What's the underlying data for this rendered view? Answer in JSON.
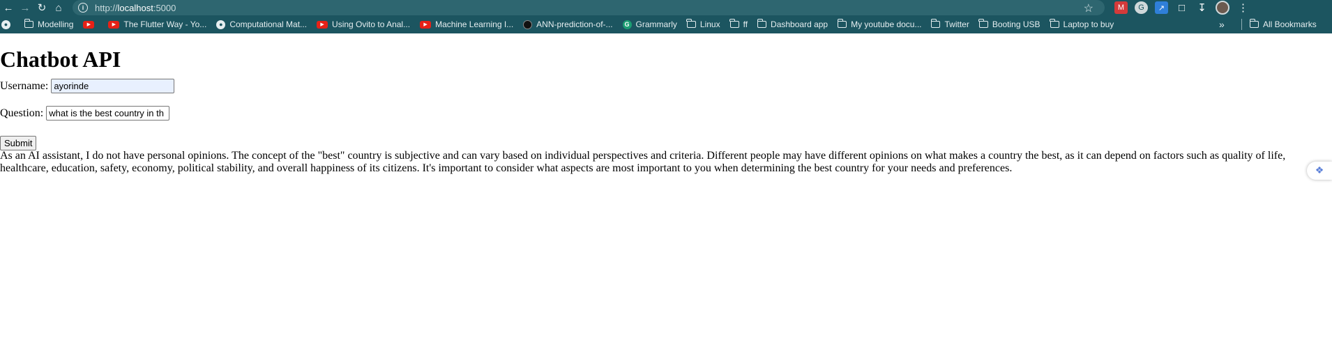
{
  "browser": {
    "url_prefix": "http://",
    "url_host": "localhost",
    "url_port": ":5000",
    "bookmarks": [
      {
        "label": "Modelling",
        "icon": "folder-icon"
      },
      {
        "label": "",
        "icon": "youtube-icon"
      },
      {
        "label": "The Flutter Way - Yo...",
        "icon": "youtube-icon"
      },
      {
        "label": "Computational Mat...",
        "icon": "globe-icon"
      },
      {
        "label": "Using Ovito to Anal...",
        "icon": "youtube-icon"
      },
      {
        "label": "Machine Learning I...",
        "icon": "youtube-icon"
      },
      {
        "label": "ANN-prediction-of-...",
        "icon": "github-icon"
      },
      {
        "label": "Grammarly",
        "icon": "grammarly-icon"
      },
      {
        "label": "Linux",
        "icon": "folder-icon"
      },
      {
        "label": "ff",
        "icon": "folder-icon"
      },
      {
        "label": "Dashboard app",
        "icon": "folder-icon"
      },
      {
        "label": "My youtube docu...",
        "icon": "folder-icon"
      },
      {
        "label": "Twitter",
        "icon": "folder-icon"
      },
      {
        "label": "Booting USB",
        "icon": "folder-icon"
      },
      {
        "label": "Laptop to buy",
        "icon": "folder-icon"
      }
    ],
    "all_bookmarks": "All Bookmarks"
  },
  "page": {
    "title": "Chatbot API",
    "username_label": "Username:",
    "username_value": "ayorinde",
    "question_label": "Question:",
    "question_value": "what is the best country in th",
    "submit_label": "Submit",
    "answer": "As an AI assistant, I do not have personal opinions. The concept of the \"best\" country is subjective and can vary based on individual perspectives and criteria. Different people may have different opinions on what makes a country the best, as it can depend on factors such as quality of life, healthcare, education, safety, economy, political stability, and overall happiness of its citizens. It's important to consider what aspects are most important to you when determining the best country for your needs and preferences."
  }
}
